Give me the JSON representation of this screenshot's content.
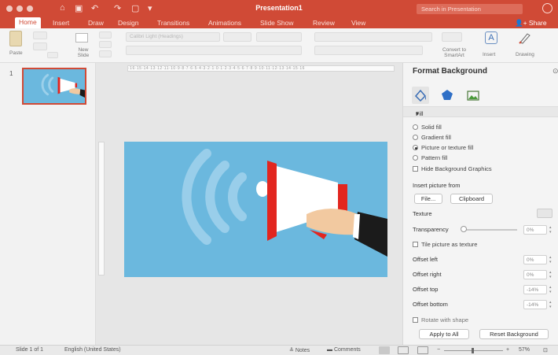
{
  "window": {
    "title": "Presentation1",
    "search_placeholder": "Search in Presentation"
  },
  "ribbon": {
    "tabs": [
      "Home",
      "Insert",
      "Draw",
      "Design",
      "Transitions",
      "Animations",
      "Slide Show",
      "Review",
      "View"
    ],
    "active_tab": "Home",
    "share_label": "Share",
    "font_name": "Calibri Light (Headings)",
    "paste_label": "Paste",
    "new_slide_label": "New Slide",
    "convert_label": "Convert to SmartArt",
    "insert_label": "Insert",
    "drawing_label": "Drawing"
  },
  "thumbnails": {
    "slide_number": "1"
  },
  "format_background": {
    "title": "Format Background",
    "fill_section_label": "Fill",
    "fill_options": [
      {
        "label": "Solid fill",
        "selected": false
      },
      {
        "label": "Gradient fill",
        "selected": false
      },
      {
        "label": "Picture or texture fill",
        "selected": true
      },
      {
        "label": "Pattern fill",
        "selected": false
      }
    ],
    "hide_graphics_label": "Hide Background Graphics",
    "insert_picture_label": "Insert picture from",
    "file_button": "File...",
    "clipboard_button": "Clipboard",
    "texture_label": "Texture",
    "transparency_label": "Transparency",
    "transparency_value": "0%",
    "tile_label": "Tile picture as texture",
    "offset_left_label": "Offset left",
    "offset_left_value": "0%",
    "offset_right_label": "Offset right",
    "offset_right_value": "0%",
    "offset_top_label": "Offset top",
    "offset_top_value": "-14%",
    "offset_bottom_label": "Offset bottom",
    "offset_bottom_value": "-14%",
    "rotate_label": "Rotate with shape",
    "apply_all_button": "Apply to All",
    "reset_button": "Reset Background"
  },
  "status_bar": {
    "slide_info": "Slide 1 of 1",
    "language": "English (United States)",
    "notes_label": "Notes",
    "comments_label": "Comments",
    "zoom_label": "57%"
  },
  "colors": {
    "accent": "#d04a36",
    "slide_background": "#6bb8de",
    "megaphone_red": "#e2261f"
  }
}
